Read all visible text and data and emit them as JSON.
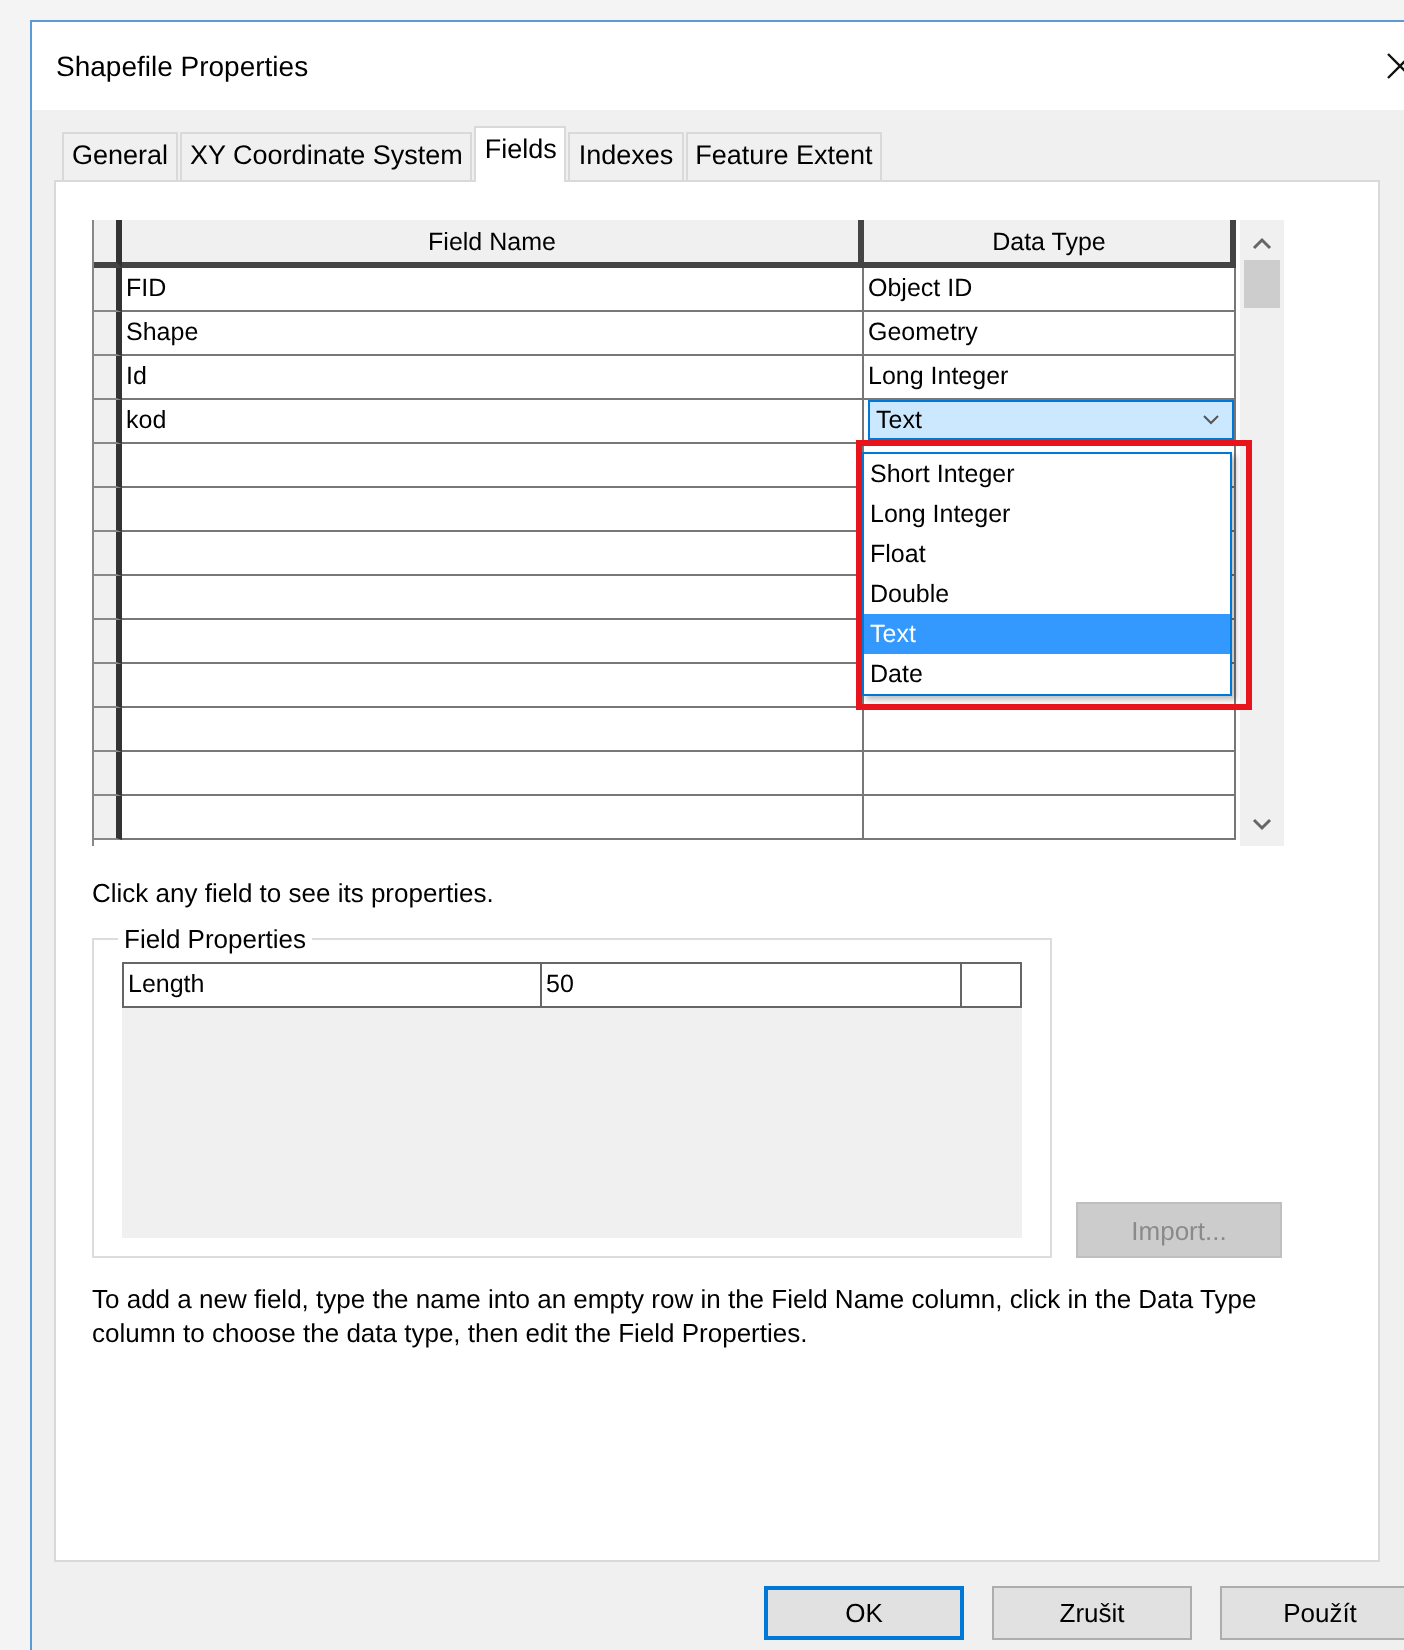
{
  "window": {
    "title": "Shapefile Properties"
  },
  "tabs": [
    {
      "label": "General",
      "selected": false
    },
    {
      "label": "XY Coordinate System",
      "selected": false
    },
    {
      "label": "Fields",
      "selected": true
    },
    {
      "label": "Indexes",
      "selected": false
    },
    {
      "label": "Feature Extent",
      "selected": false
    }
  ],
  "fields_grid": {
    "columns": [
      "Field Name",
      "Data Type"
    ],
    "rows": [
      {
        "kind": "filled",
        "field_name": "FID",
        "data_type": "Object ID"
      },
      {
        "kind": "filled",
        "field_name": "Shape",
        "data_type": "Geometry"
      },
      {
        "kind": "filled",
        "field_name": "Id",
        "data_type": "Long Integer"
      },
      {
        "kind": "editing",
        "field_name": "kod",
        "data_type": "Text"
      },
      {
        "kind": "empty"
      },
      {
        "kind": "empty"
      },
      {
        "kind": "empty"
      },
      {
        "kind": "empty"
      },
      {
        "kind": "empty"
      },
      {
        "kind": "empty"
      },
      {
        "kind": "empty"
      },
      {
        "kind": "empty"
      },
      {
        "kind": "empty"
      }
    ],
    "dropdown": {
      "options": [
        {
          "label": "Short Integer",
          "selected": false
        },
        {
          "label": "Long Integer",
          "selected": false
        },
        {
          "label": "Float",
          "selected": false
        },
        {
          "label": "Double",
          "selected": false
        },
        {
          "label": "Text",
          "selected": true
        },
        {
          "label": "Date",
          "selected": false
        }
      ]
    }
  },
  "hint": "Click any field to see its properties.",
  "field_properties": {
    "title": "Field Properties",
    "rows": [
      {
        "name": "Length",
        "value": "50"
      }
    ]
  },
  "import_button": {
    "label": "Import...",
    "disabled": true
  },
  "help_text": "To add a new field, type the name into an empty row in the Field Name column, click in the Data Type column to choose the data type, then edit the Field Properties.",
  "buttons": [
    {
      "label": "OK",
      "default": true
    },
    {
      "label": "Zrušit",
      "default": false
    },
    {
      "label": "Použít",
      "default": false
    }
  ]
}
